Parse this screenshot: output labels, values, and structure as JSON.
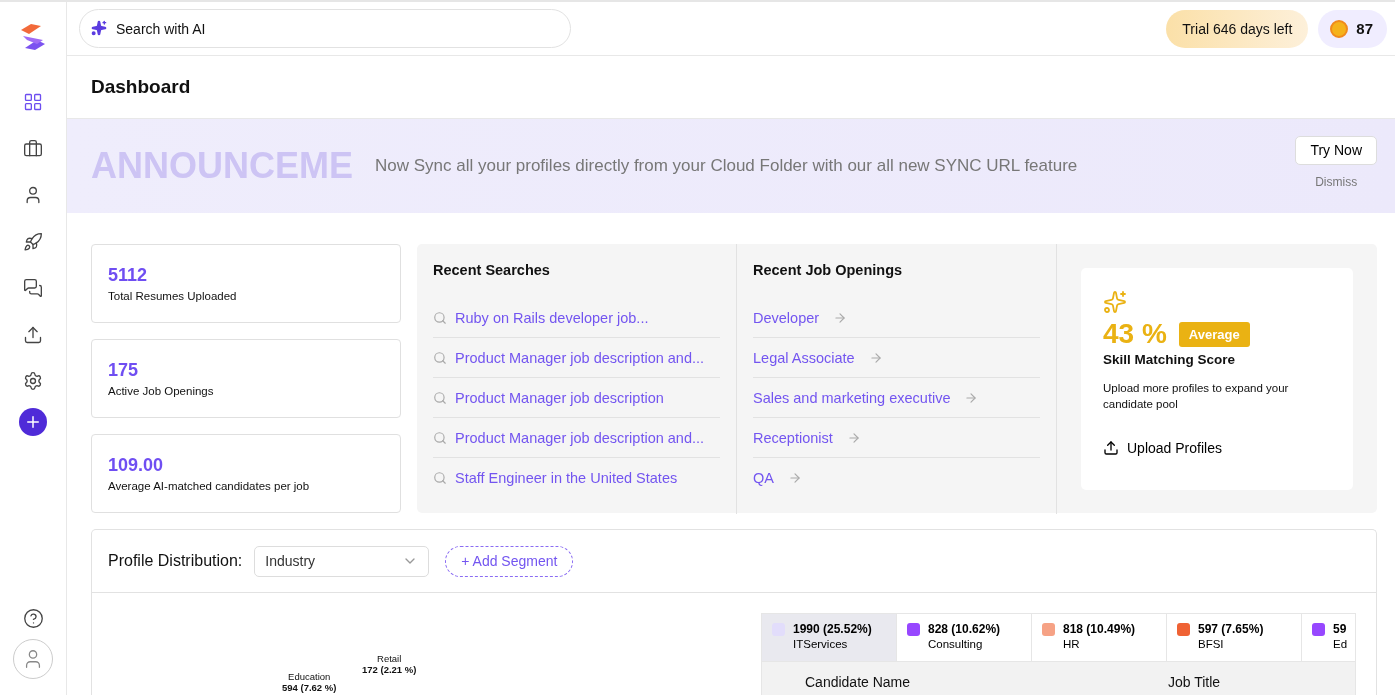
{
  "sidebar": {
    "items": [
      {
        "kind": "grid",
        "selected": true
      },
      {
        "kind": "briefcase",
        "selected": false
      },
      {
        "kind": "user",
        "selected": false
      },
      {
        "kind": "rocket",
        "selected": false
      },
      {
        "kind": "chat",
        "selected": false
      },
      {
        "kind": "upload",
        "selected": false
      },
      {
        "kind": "settings",
        "selected": false
      }
    ]
  },
  "topbar": {
    "search_placeholder": "Search with AI",
    "trial": "Trial 646 days left",
    "credits": "87"
  },
  "page_title": "Dashboard",
  "announcement": {
    "watermark": "ANNOUNCEME",
    "message": "Now Sync all your profiles directly from your Cloud Folder with our all new SYNC URL feature",
    "button": "Try Now",
    "dismiss": "Dismiss"
  },
  "stats": [
    {
      "value": "5112",
      "label": "Total Resumes Uploaded"
    },
    {
      "value": "175",
      "label": "Active Job Openings"
    },
    {
      "value": "109.00",
      "label": "Average AI-matched candidates per job"
    }
  ],
  "recent_searches": {
    "title": "Recent Searches",
    "items": [
      "Ruby on Rails developer job...",
      "Product Manager job description and...",
      "Product Manager job description",
      "Product Manager job description and...",
      "Staff Engineer in the United States"
    ]
  },
  "recent_jobs": {
    "title": "Recent Job Openings",
    "items": [
      "Developer",
      "Legal Associate",
      "Sales and marketing executive",
      "Receptionist",
      "QA"
    ]
  },
  "skill_score": {
    "value": "43 %",
    "badge": "Average",
    "title": "Skill Matching Score",
    "text": "Upload more profiles to expand your candidate pool",
    "action": "Upload Profiles"
  },
  "distribution": {
    "label": "Profile Distribution:",
    "dropdown": "Industry",
    "add_segment": "+ Add Segment",
    "chart_labels": [
      {
        "name": "Education",
        "value": "594 (7.62 %)"
      },
      {
        "name": "Retail",
        "value": "172 (2.21 %)"
      }
    ],
    "legend": [
      {
        "value": "1990 (25.52%)",
        "name": "ITServices",
        "color": "#e2ddfb",
        "selected": true
      },
      {
        "value": "828 (10.62%)",
        "name": "Consulting",
        "color": "#9747ff",
        "selected": false
      },
      {
        "value": "818 (10.49%)",
        "name": "HR",
        "color": "#f6a285",
        "selected": false
      },
      {
        "value": "597 (7.65%)",
        "name": "BFSI",
        "color": "#ef6234",
        "selected": false
      },
      {
        "value": "59",
        "name": "Ed",
        "color": "#9747ff",
        "selected": false
      }
    ],
    "table_columns": [
      "Candidate Name",
      "Job Title"
    ]
  }
}
